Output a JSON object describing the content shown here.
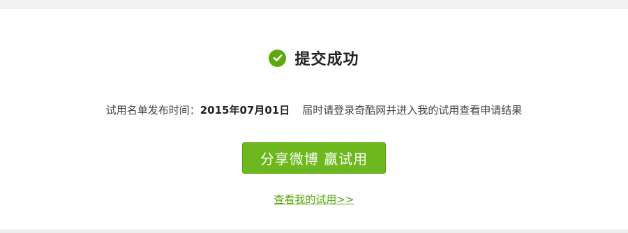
{
  "status": {
    "title": "提交成功",
    "icon": "check-circle-icon",
    "icon_color": "#5fa80c"
  },
  "info": {
    "label": "试用名单发布时间：",
    "date": "2015年07月01日",
    "message": "届时请登录奇酷网并进入我的试用查看申请结果"
  },
  "actions": {
    "share_button_label": "分享微博  赢试用",
    "share_button_color": "#6cb81e",
    "my_trials_link_label": "查看我的试用>>",
    "link_color": "#5aa810"
  }
}
